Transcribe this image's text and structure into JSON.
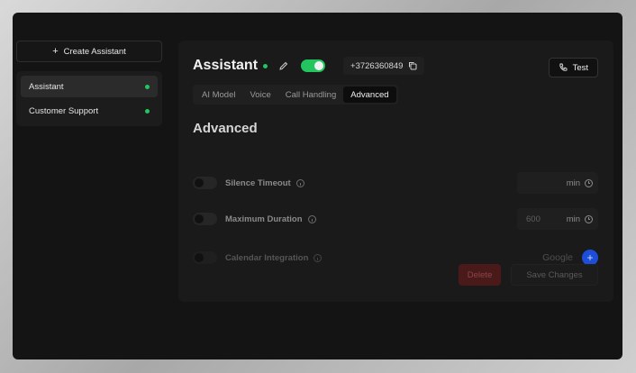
{
  "sidebar": {
    "create_label": "Create Assistant",
    "items": [
      {
        "label": "Assistant",
        "active": true,
        "status": "active"
      },
      {
        "label": "Customer Support",
        "active": false,
        "status": "active"
      }
    ]
  },
  "header": {
    "title": "Assistant",
    "phone": "+3726360849",
    "test_label": "Test",
    "enabled": true
  },
  "tabs": [
    {
      "label": "AI Model",
      "active": false
    },
    {
      "label": "Voice",
      "active": false
    },
    {
      "label": "Call Handling",
      "active": false
    },
    {
      "label": "Advanced",
      "active": true
    }
  ],
  "section": {
    "title": "Advanced",
    "settings": [
      {
        "label": "Silence Timeout",
        "value": "",
        "unit": "min",
        "enabled": false
      },
      {
        "label": "Maximum Duration",
        "value": "600",
        "unit": "min",
        "enabled": false
      },
      {
        "label": "Calendar Integration",
        "provider": "Google",
        "enabled": false
      }
    ]
  },
  "footer": {
    "delete_label": "Delete",
    "save_label": "Save Changes"
  },
  "colors": {
    "accent_green": "#22c55e",
    "google_blue": "#1d4ed8",
    "delete_red": "#4a1a1a"
  }
}
